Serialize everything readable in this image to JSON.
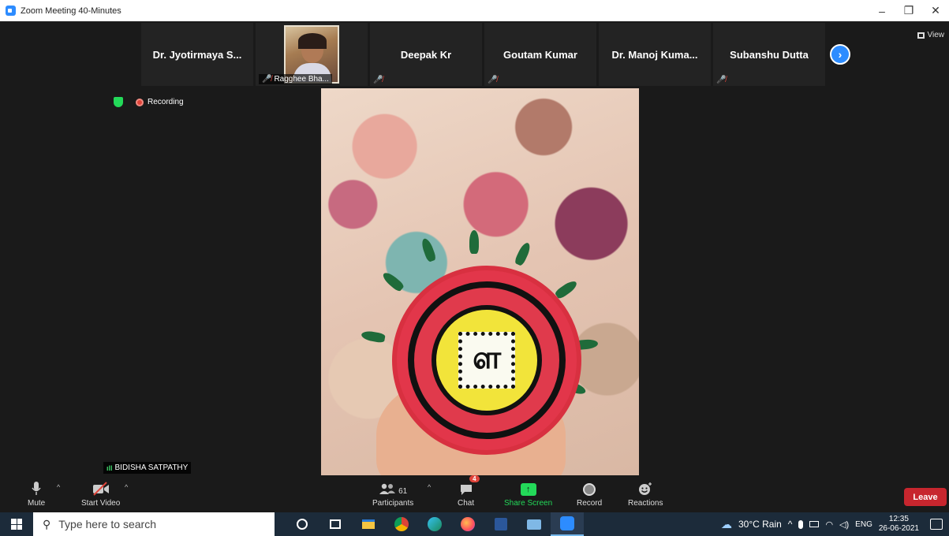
{
  "window": {
    "title": "Zoom Meeting 40-Minutes",
    "minimize": "–",
    "restore": "❐",
    "close": "✕"
  },
  "participants_strip": [
    {
      "name": "Dr. Jyotirmaya S...",
      "muted": false
    },
    {
      "name": "Ragghee Bha...",
      "muted": true,
      "video": true
    },
    {
      "name": "Deepak Kr",
      "muted": true
    },
    {
      "name": "Goutam Kumar",
      "muted": true
    },
    {
      "name": "Dr. Manoj Kuma...",
      "muted": false
    },
    {
      "name": "Subanshu Dutta",
      "muted": true
    }
  ],
  "mic_muted_glyph": "🎤̸",
  "next_page_glyph": "›",
  "view_label": "View",
  "recording_label": "Recording",
  "active_speaker": {
    "name": "BIDISHA SATPATHY",
    "signal_glyph": "ıll"
  },
  "video_symbol": "ள",
  "toolbar": {
    "mute": "Mute",
    "start_video": "Start Video",
    "participants": "Participants",
    "participants_count": "61",
    "chat": "Chat",
    "chat_badge": "4",
    "share_screen": "Share Screen",
    "record": "Record",
    "reactions": "Reactions",
    "leave": "Leave",
    "caret": "^"
  },
  "taskbar": {
    "search_placeholder": "Type here to search",
    "weather": "30°C  Rain",
    "language": "ENG",
    "time": "12:35",
    "date": "26-06-2021",
    "tray_caret": "^"
  },
  "colors": {
    "zoom_blue": "#2d8cff",
    "share_green": "#23d959",
    "leave_red": "#c7262e",
    "muted_red": "#e0443a"
  }
}
